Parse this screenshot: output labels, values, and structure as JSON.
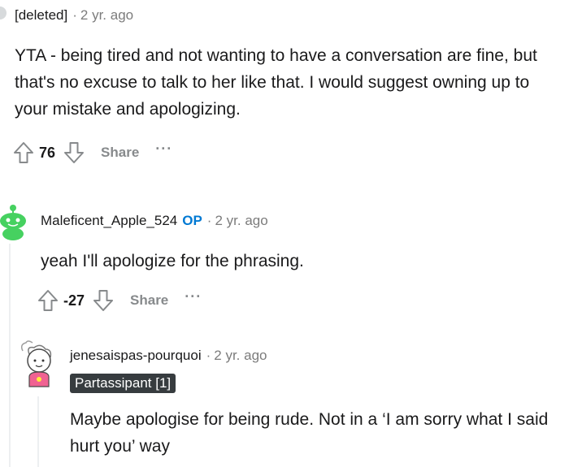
{
  "comments": [
    {
      "author": "[deleted]",
      "separator": "·",
      "time": "2 yr. ago",
      "body": "YTA - being tired and not wanting to have a conversation are fine, but that's no excuse to talk to her like that. I would suggest owning up to your mistake and apologizing.",
      "score": "76",
      "share_label": "Share",
      "more_label": "···"
    },
    {
      "author": "Maleficent_Apple_524",
      "op_badge": "OP",
      "separator": "·",
      "time": "2 yr. ago",
      "body": "yeah I'll apologize for the phrasing.",
      "score": "-27",
      "share_label": "Share",
      "more_label": "···"
    },
    {
      "author": "jenesaispas-pourquoi",
      "separator": "·",
      "time": "2 yr. ago",
      "flair": "Partassipant [1]",
      "body": "Maybe apologise for being rude. Not in a ‘I am sorry what I said hurt you’ way"
    }
  ],
  "colors": {
    "op_badge": "#0079d3",
    "flair_bg": "#373c3f",
    "muted": "#878a8c",
    "snoo_green": "#46d160"
  },
  "icons": [
    "upvote-icon",
    "downvote-icon",
    "more-icon",
    "snoo-avatar",
    "avatar-icon"
  ]
}
